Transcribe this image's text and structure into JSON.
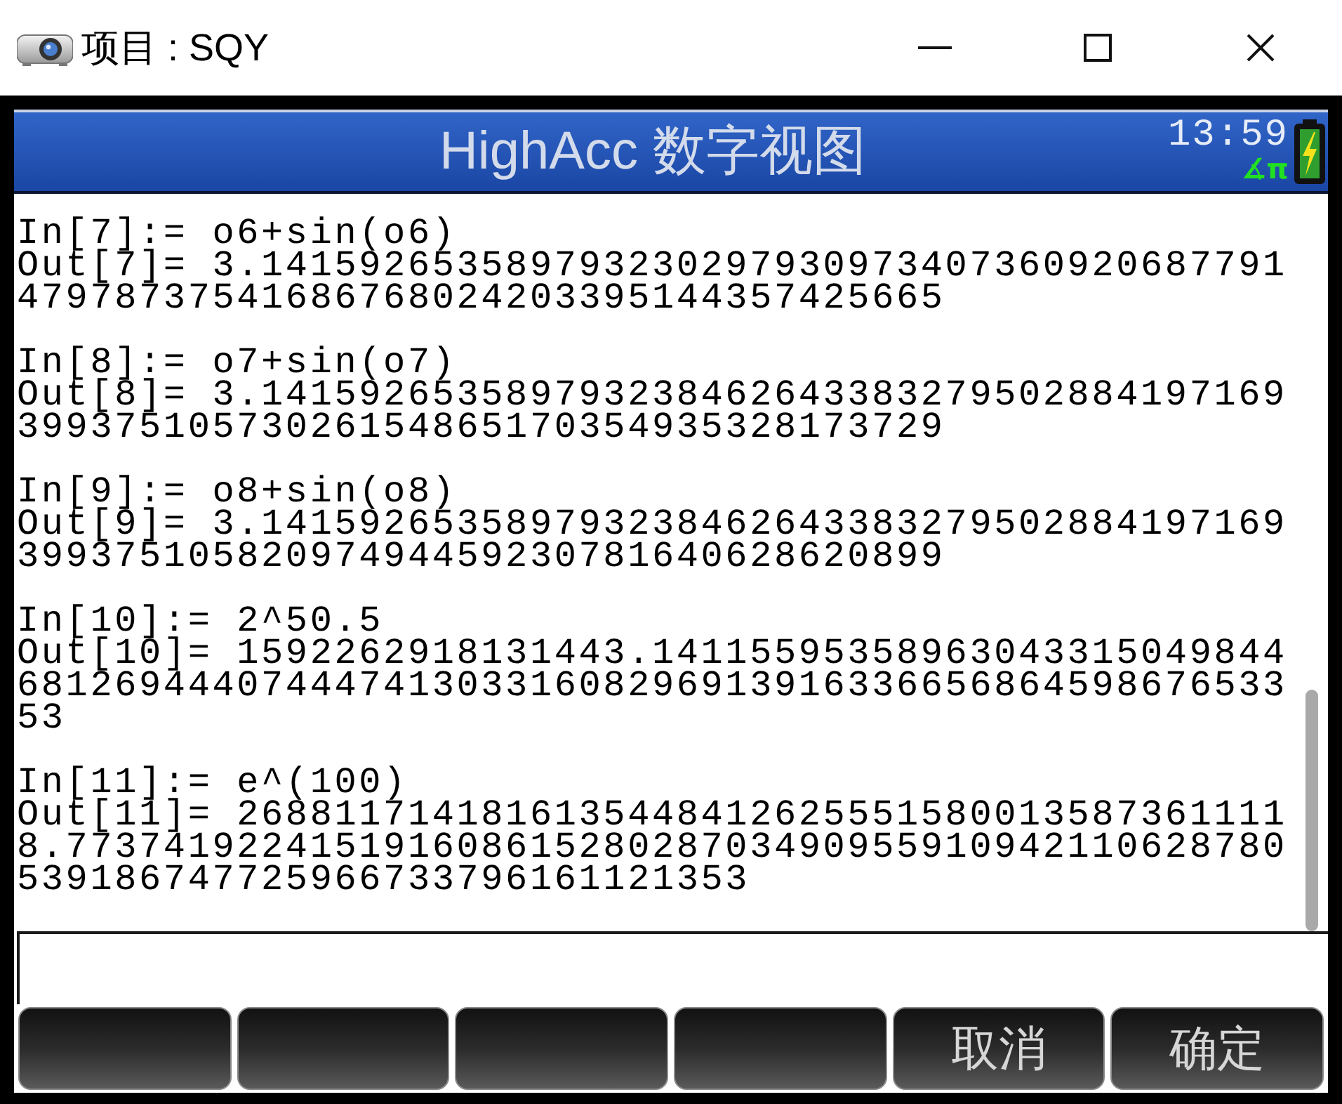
{
  "window": {
    "title": "项目 : SQY"
  },
  "header": {
    "title": "HighAcc 数字视图",
    "time": "13:59",
    "angle_mode": "∡π"
  },
  "history": [
    {
      "input": "In[7]:= o6+sin(o6)",
      "output": [
        "Out[7]= 3.141592653589793230297930973407360920687791",
        "47978737541686768024203395144357425665"
      ]
    },
    {
      "input": "In[8]:= o7+sin(o7)",
      "output": [
        "Out[8]= 3.141592653589793238462643383279502884197169",
        "39937510573026154865170354935328173729"
      ]
    },
    {
      "input": "In[9]:= o8+sin(o8)",
      "output": [
        "Out[9]= 3.141592653589793238462643383279502884197169",
        "39937510582097494459230781640628620899"
      ]
    },
    {
      "input": "In[10]:= 2^50.5",
      "output": [
        "Out[10]= 1592262918131443.14115595358963043315049844",
        "6812694440744474130331608296913916336656864598676533",
        "53"
      ]
    },
    {
      "input": "In[11]:= e^(100)",
      "output": [
        "Out[11]= 2688117141816135448412625551580013587361111",
        "8.77374192241519160861528028703490955910942110628780",
        "539186747725966733796161121353"
      ]
    }
  ],
  "softkeys": [
    {
      "kind": "blank"
    },
    {
      "kind": "blank"
    },
    {
      "kind": "blank"
    },
    {
      "kind": "blank"
    },
    {
      "kind": "labeled",
      "label": "取消"
    },
    {
      "kind": "labeled",
      "label": "确定"
    }
  ]
}
